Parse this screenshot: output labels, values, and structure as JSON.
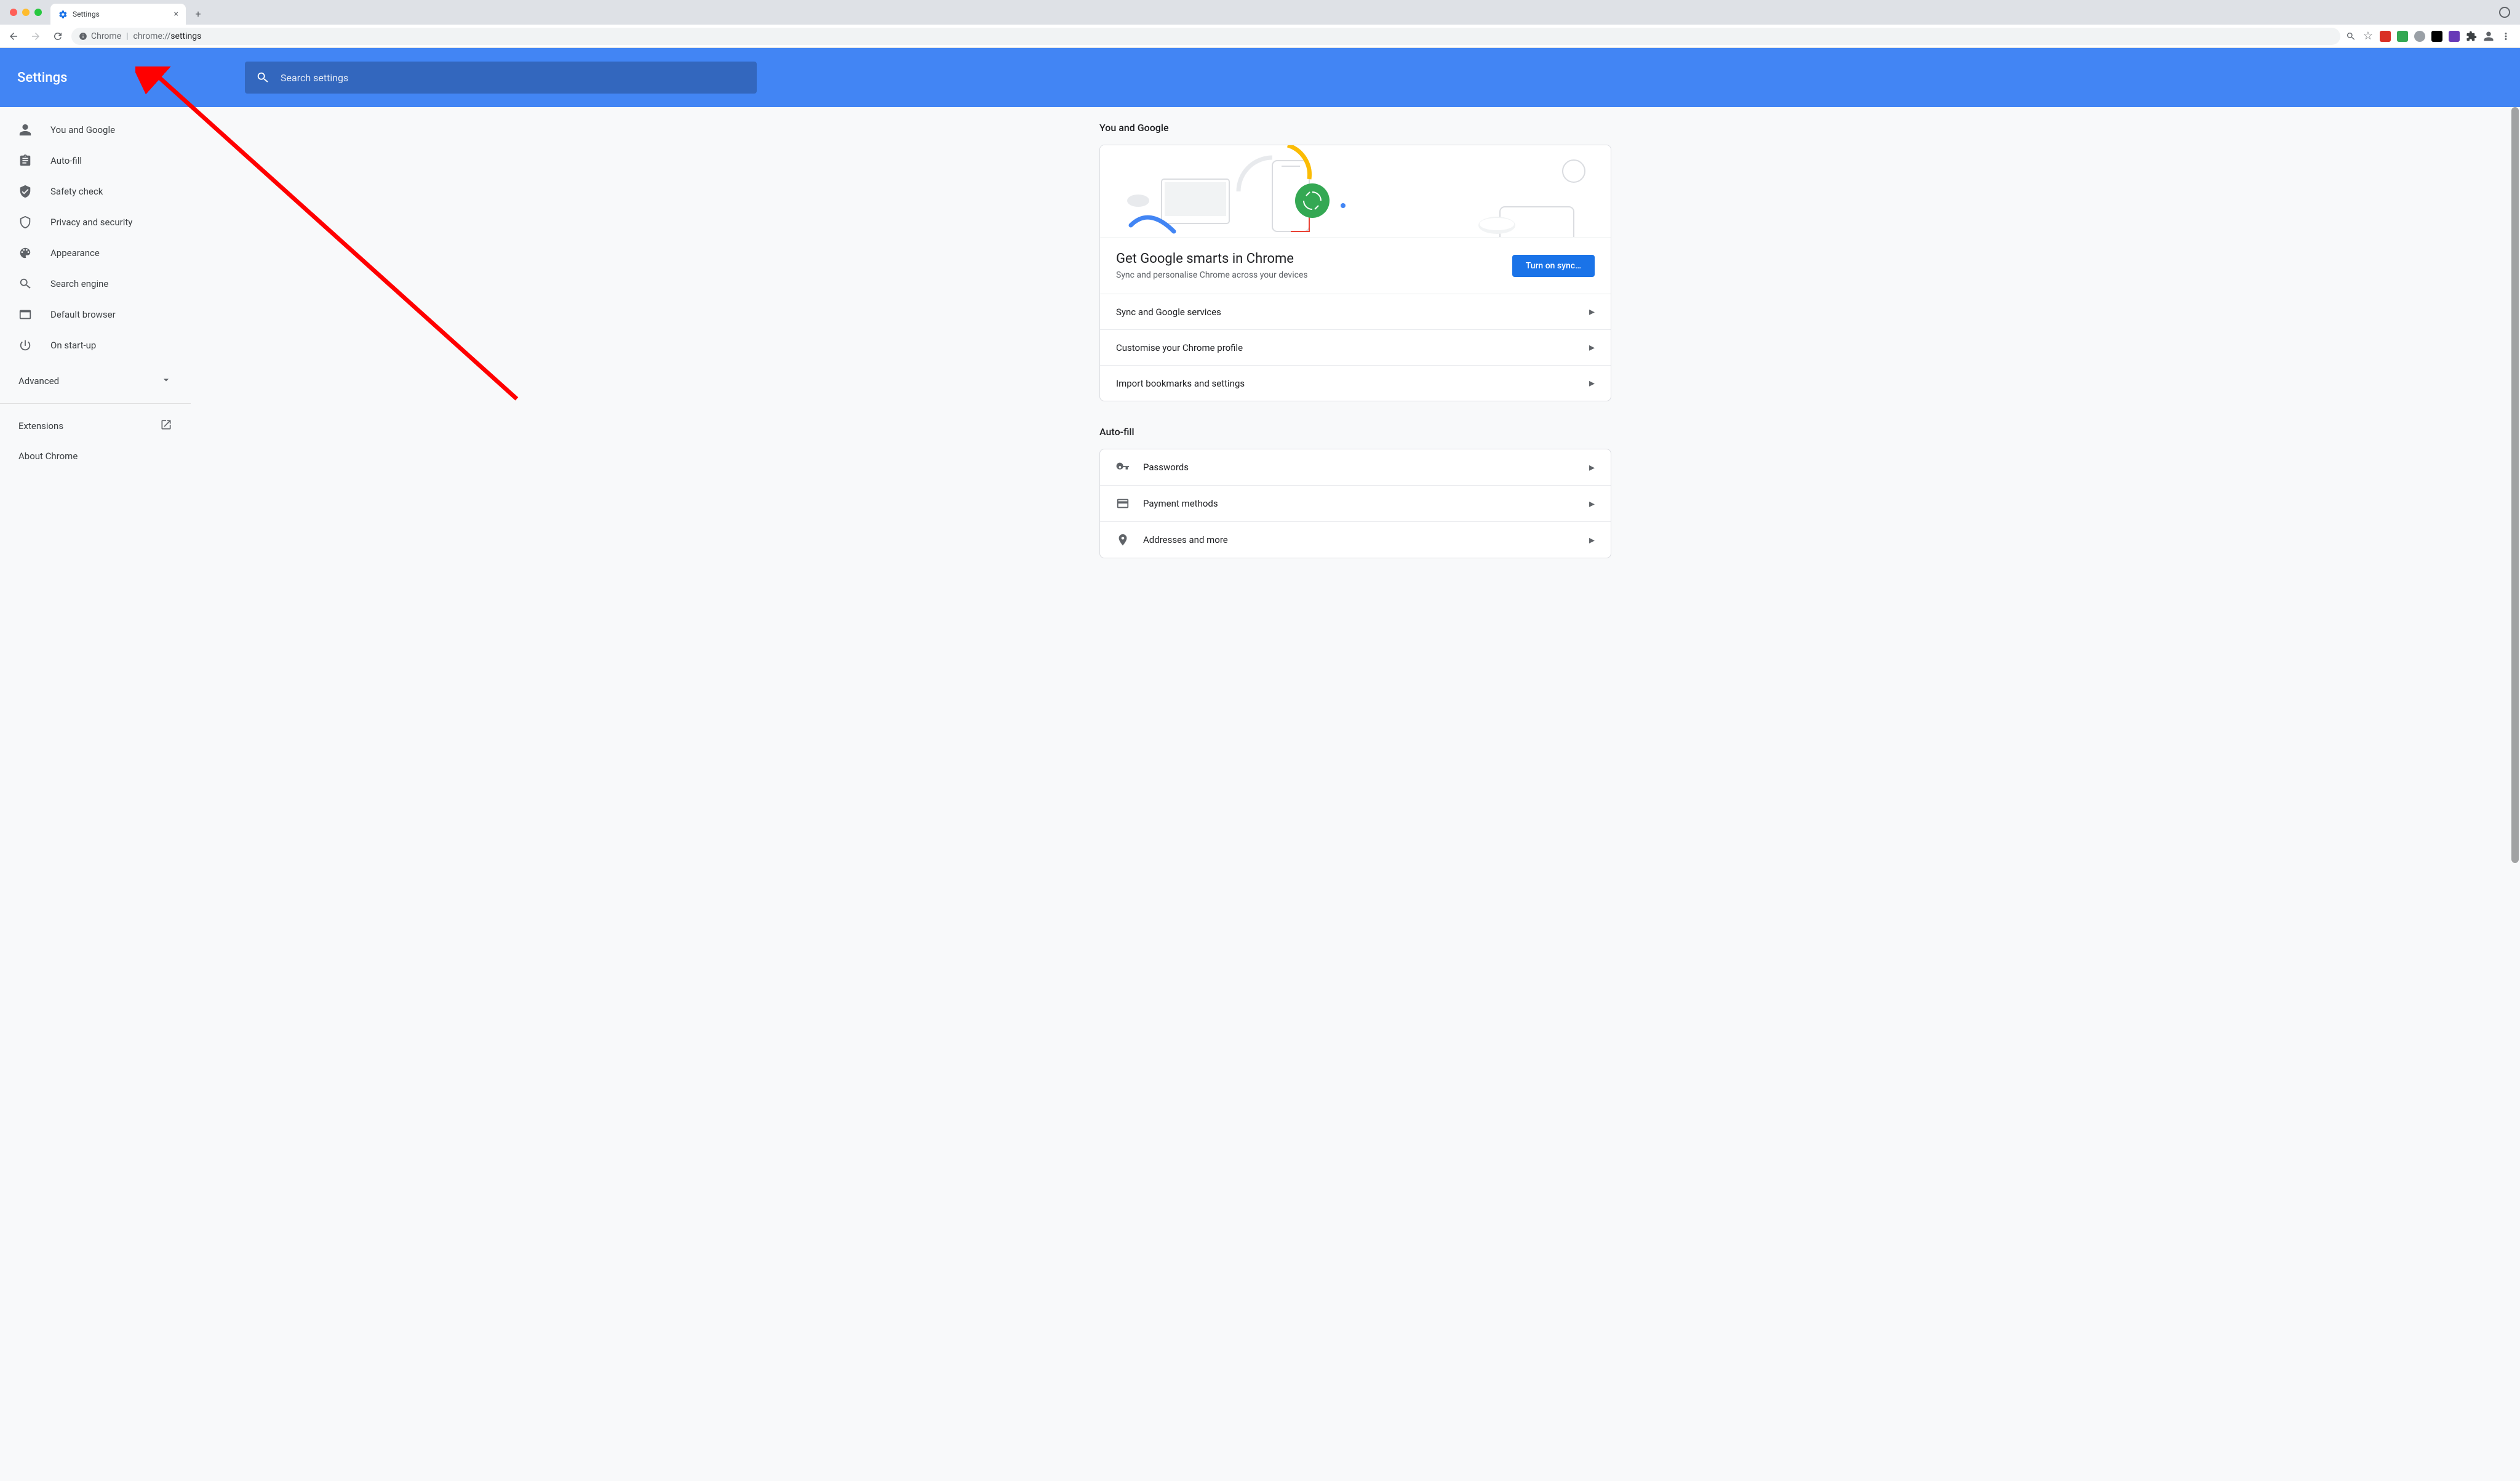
{
  "browser": {
    "tab_title": "Settings",
    "omnibox_chip": "Chrome",
    "omnibox_scheme": "chrome://",
    "omnibox_path": "settings"
  },
  "header": {
    "title": "Settings",
    "search_placeholder": "Search settings"
  },
  "sidebar": {
    "items": [
      {
        "label": "You and Google"
      },
      {
        "label": "Auto-fill"
      },
      {
        "label": "Safety check"
      },
      {
        "label": "Privacy and security"
      },
      {
        "label": "Appearance"
      },
      {
        "label": "Search engine"
      },
      {
        "label": "Default browser"
      },
      {
        "label": "On start-up"
      }
    ],
    "advanced_label": "Advanced",
    "extensions_label": "Extensions",
    "about_label": "About Chrome"
  },
  "sections": {
    "you_and_google": {
      "title": "You and Google",
      "sync_heading": "Get Google smarts in Chrome",
      "sync_sub": "Sync and personalise Chrome across your devices",
      "sync_button": "Turn on sync…",
      "rows": [
        {
          "label": "Sync and Google services"
        },
        {
          "label": "Customise your Chrome profile"
        },
        {
          "label": "Import bookmarks and settings"
        }
      ]
    },
    "autofill": {
      "title": "Auto-fill",
      "rows": [
        {
          "label": "Passwords"
        },
        {
          "label": "Payment methods"
        },
        {
          "label": "Addresses and more"
        }
      ]
    }
  }
}
